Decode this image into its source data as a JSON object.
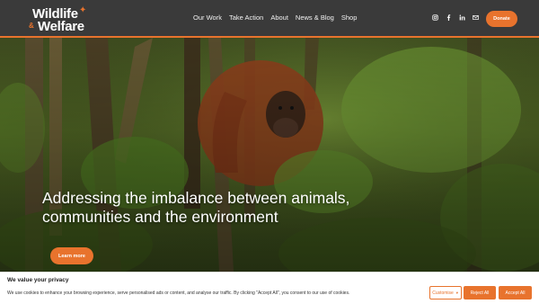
{
  "header": {
    "logo_top": "Wildlife",
    "logo_amp": "&",
    "logo_bottom": "Welfare",
    "nav": [
      "Our Work",
      "Take Action",
      "About",
      "News & Blog",
      "Shop"
    ],
    "social_icons": [
      "instagram-icon",
      "facebook-icon",
      "linkedin-icon",
      "mail-icon"
    ],
    "donate_label": "Donate"
  },
  "hero": {
    "title": "Addressing the imbalance between animals, communities and the environment",
    "cta_label": "Learn more"
  },
  "cookie": {
    "title": "We value your privacy",
    "text": "We use cookies to enhance your browsing experience, serve personalised ads or content, and analyse our traffic. By clicking \"Accept All\", you consent to our use of cookies.",
    "customise_label": "Customise",
    "reject_label": "Reject All",
    "accept_label": "Accept All"
  },
  "colors": {
    "accent": "#e8732d",
    "header_bg": "#3a3a3a"
  }
}
